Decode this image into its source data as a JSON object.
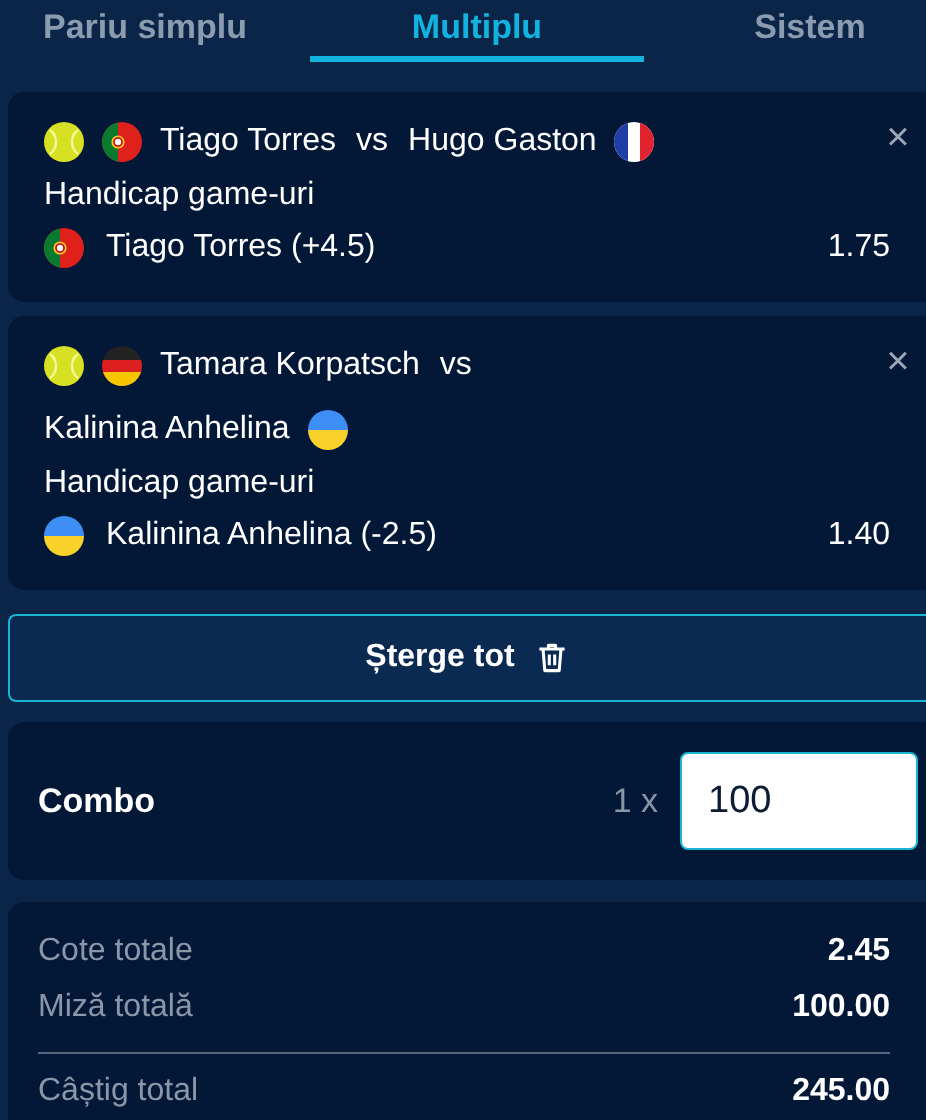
{
  "tabs": [
    {
      "label": "Pariu simplu",
      "selected": false
    },
    {
      "label": "Multiplu",
      "selected": true
    },
    {
      "label": "Sistem",
      "selected": false
    }
  ],
  "selections": [
    {
      "home": {
        "name": "Tiago Torres",
        "kind": "pt"
      },
      "vs": "vs",
      "away": {
        "name": "Hugo Gaston",
        "kind": "fr"
      },
      "close": "×",
      "market": "Handicap game-uri",
      "pick": {
        "kind": "pt",
        "label": "Tiago Torres (+4.5)"
      },
      "odds": "1.75"
    },
    {
      "home": {
        "name": "Tamara Korpatsch",
        "kind": "de"
      },
      "vs": "vs",
      "away": {
        "name": "Kalinina Anhelina",
        "kind": "ua"
      },
      "close": "×",
      "market": "Handicap game-uri",
      "pick": {
        "kind": "ua",
        "label": "Kalinina Anhelina (-2.5)"
      },
      "odds": "1.40"
    }
  ],
  "clear_button": "Șterge tot",
  "combo": {
    "label": "Combo",
    "multiplier": "1 x",
    "stake": "100"
  },
  "totals": [
    {
      "label": "Cote totale",
      "value": "2.45"
    },
    {
      "label": "Miză totală",
      "value": "100.00"
    },
    {
      "label": "Câștig total",
      "value": "245.00",
      "divider_above": true
    }
  ]
}
